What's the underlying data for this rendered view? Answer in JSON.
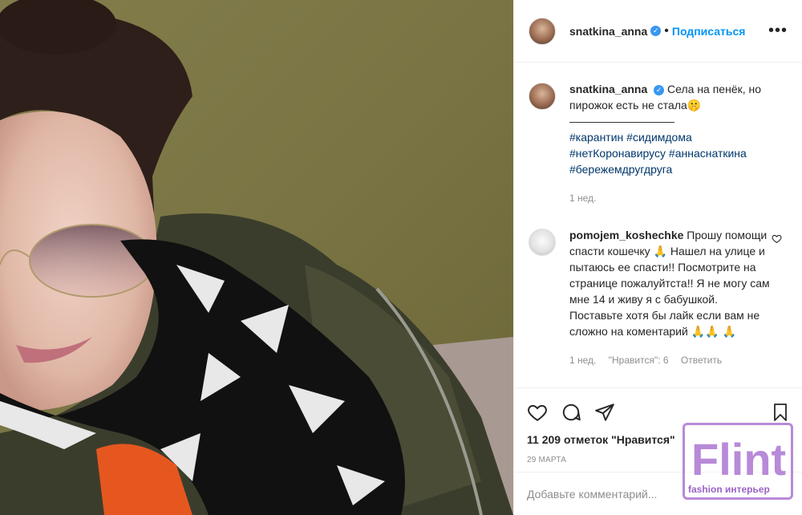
{
  "post": {
    "username": "snatkina_anna",
    "follow_label": "Подписаться",
    "more_label": "•••",
    "caption_line1": "Села на пенёк, но пирожок есть не стала🤫",
    "caption_divider": "——————————",
    "hashtags": [
      "#карантин",
      "#сидимдома",
      "#нетКоронавирусу",
      "#аннаснаткина",
      "#бережемдругдруга"
    ],
    "caption_age": "1 нед."
  },
  "comment": {
    "username": "pomojem_koshechke",
    "text": "Прошу помощи спасти кошечку 🙏 Нашел на улице и пытаюсь ее спасти!! Посмотрите на странице пожалуйтста!! Я не могу сам мне 14 и живу я с бабушкой. Поставьте хотя бы лайк если вам не сложно на коментарий 🙏🙏 🙏",
    "age": "1 нед.",
    "likes": "\"Нравится\": 6",
    "reply_label": "Ответить"
  },
  "stats": {
    "likes": "11 209 отметок \"Нравится\"",
    "date": "29 марта"
  },
  "add_comment": {
    "placeholder": "Добавьте комментарий..."
  },
  "watermark": {
    "logo_text": "Flint",
    "tagline": "fashion интерьер"
  },
  "colors": {
    "link": "#0095f6",
    "hashtag": "#00376b",
    "muted": "#8e8e8e",
    "watermark": "#b88ad8"
  }
}
